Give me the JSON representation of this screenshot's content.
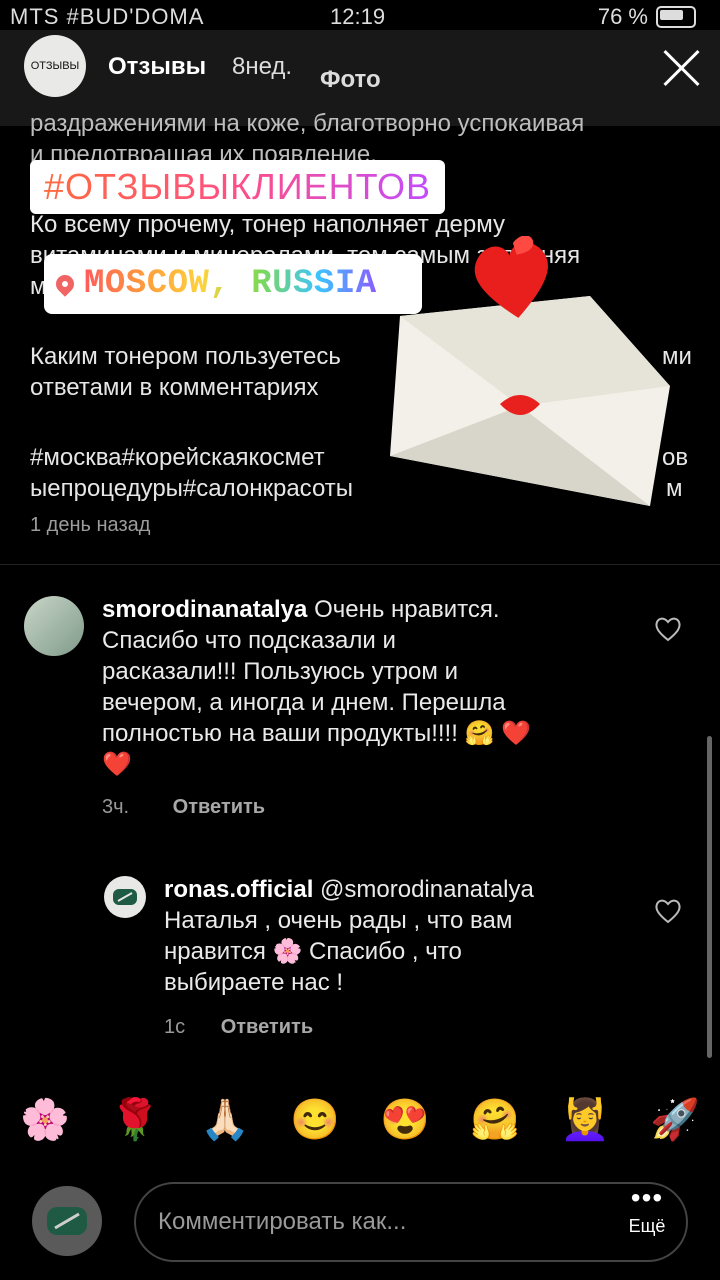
{
  "status": {
    "carrier": "MTS #BUD'DOMA",
    "time": "12:19",
    "battery": "76 %"
  },
  "story": {
    "avatar_text": "ОТЗЫВЫ",
    "name": "Отзывы",
    "age": "8нед.",
    "type": "Фото"
  },
  "caption": {
    "line1": "раздражениями на коже, благотворно успокаивая",
    "line2": "и предотвращая их появление.",
    "line3": "Ко всему прочему, тонер наполняет дерму",
    "line4": "витаминами и минералами, тем самым заполняя",
    "line5": "м",
    "line6": "Каким тонером пользуетесь",
    "line6b": "ми",
    "line7": "ответами в комментариях",
    "line8": "#москва#корейскаякосмет",
    "line8b": "ов",
    "line9": "ыепроцедуры#салонкрасоты",
    "line9b": "м",
    "timestamp": "1 день назад"
  },
  "stickers": {
    "hashtag": "#ОТЗЫВЫКЛИЕНТОВ",
    "location": "MOSCOW, RUSSIA"
  },
  "comments": [
    {
      "user": "smorodinanatalya",
      "text_line1": " Очень нравится.",
      "text_line2": "Спасибо что подсказали и",
      "text_line3": "расказали!!! Пользуюсь утром и",
      "text_line4": "вечером, а иногда и днем. Перешла",
      "text_line5": "полностью на ваши продукты!!!! 🤗 ❤️",
      "text_line6": "❤️",
      "age": "3ч.",
      "reply": "Ответить"
    },
    {
      "user": "ronas.official",
      "text_line1": " @smorodinanatalya",
      "text_line2": "Наталья , очень рады , что вам",
      "text_line3": "нравится 🌸 Спасибо , что",
      "text_line4": "выбираете нас !",
      "age": "1с",
      "reply": "Ответить"
    }
  ],
  "emoji_bar": [
    "🌸",
    "🌹",
    "🙏🏻",
    "😊",
    "😍",
    "🤗",
    "💆‍♀️",
    "🚀"
  ],
  "composer": {
    "placeholder": "Комментировать как...",
    "more_label": "Ещё"
  }
}
